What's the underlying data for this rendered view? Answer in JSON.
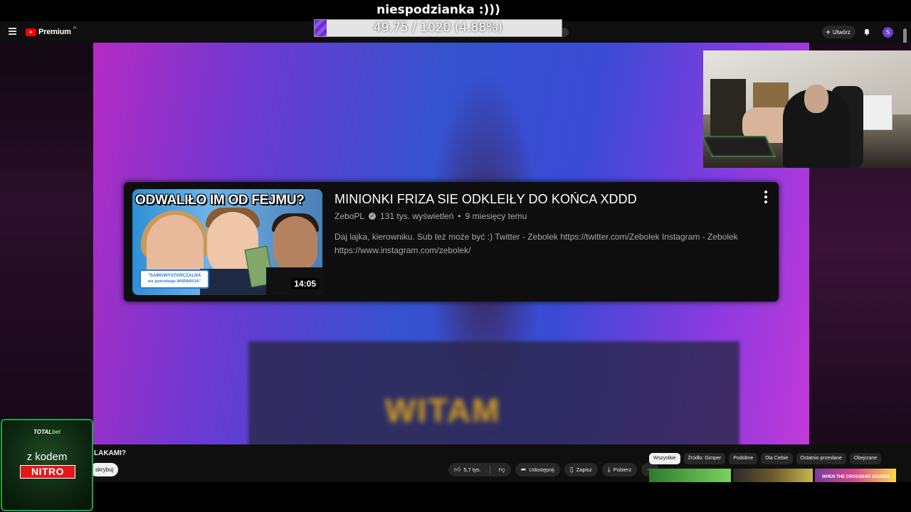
{
  "stream_overlay": {
    "goal_title": "niespodzianka :)))",
    "goal_progress_text": "49.75 / 1020 (4.88%)",
    "goal_progress_fraction": 0.0488
  },
  "header": {
    "logo_text": "Premium",
    "logo_region": "PL",
    "create_label": "Utwórz",
    "avatar_letter": "S"
  },
  "overlay_card": {
    "thumbnail_headline": "ODWALIŁO IM OD FEJMU?",
    "thumbnail_bubble_line1": "\"SAMOWYSTARCZALNA",
    "thumbnail_bubble_line2": "nie potrzebuje WSPARCIA\"",
    "duration": "14:05",
    "title": "MINIONKI FRIZA SIE ODKLEIŁY DO KOŃCA XDDD",
    "channel": "ZeboPL",
    "views": "131 tys. wyświetleń",
    "age": "9 miesięcy temu",
    "description": "Daj lajka, kierowniku. Sub też może być :) Twitter - Zebolek https://twitter.com/Zebolek Instagram - Zebolek https://www.instagram.com/zebolek/"
  },
  "video_bg": {
    "stage_text": "WITAM"
  },
  "below_video": {
    "title_fragment": "LAKAMI?",
    "subscribe_fragment": "skrybuj",
    "likes": "5,7 tys.",
    "share_label": "Udostępnij",
    "save_label": "Zapisz",
    "download_label": "Pobierz"
  },
  "chips": [
    "Wszystkie",
    "Źródło: Gimper",
    "Podobne",
    "Dla Ciebie",
    "Ostatnio przesłane",
    "Obejrzane"
  ],
  "recommendations": {
    "rec3_text": "WHEN THE CROSSBAR SOUNDS"
  },
  "sponsor": {
    "brand_part1": "TOTAL",
    "brand_part2": "bet",
    "line1": "z kodem",
    "code": "NITRO"
  }
}
